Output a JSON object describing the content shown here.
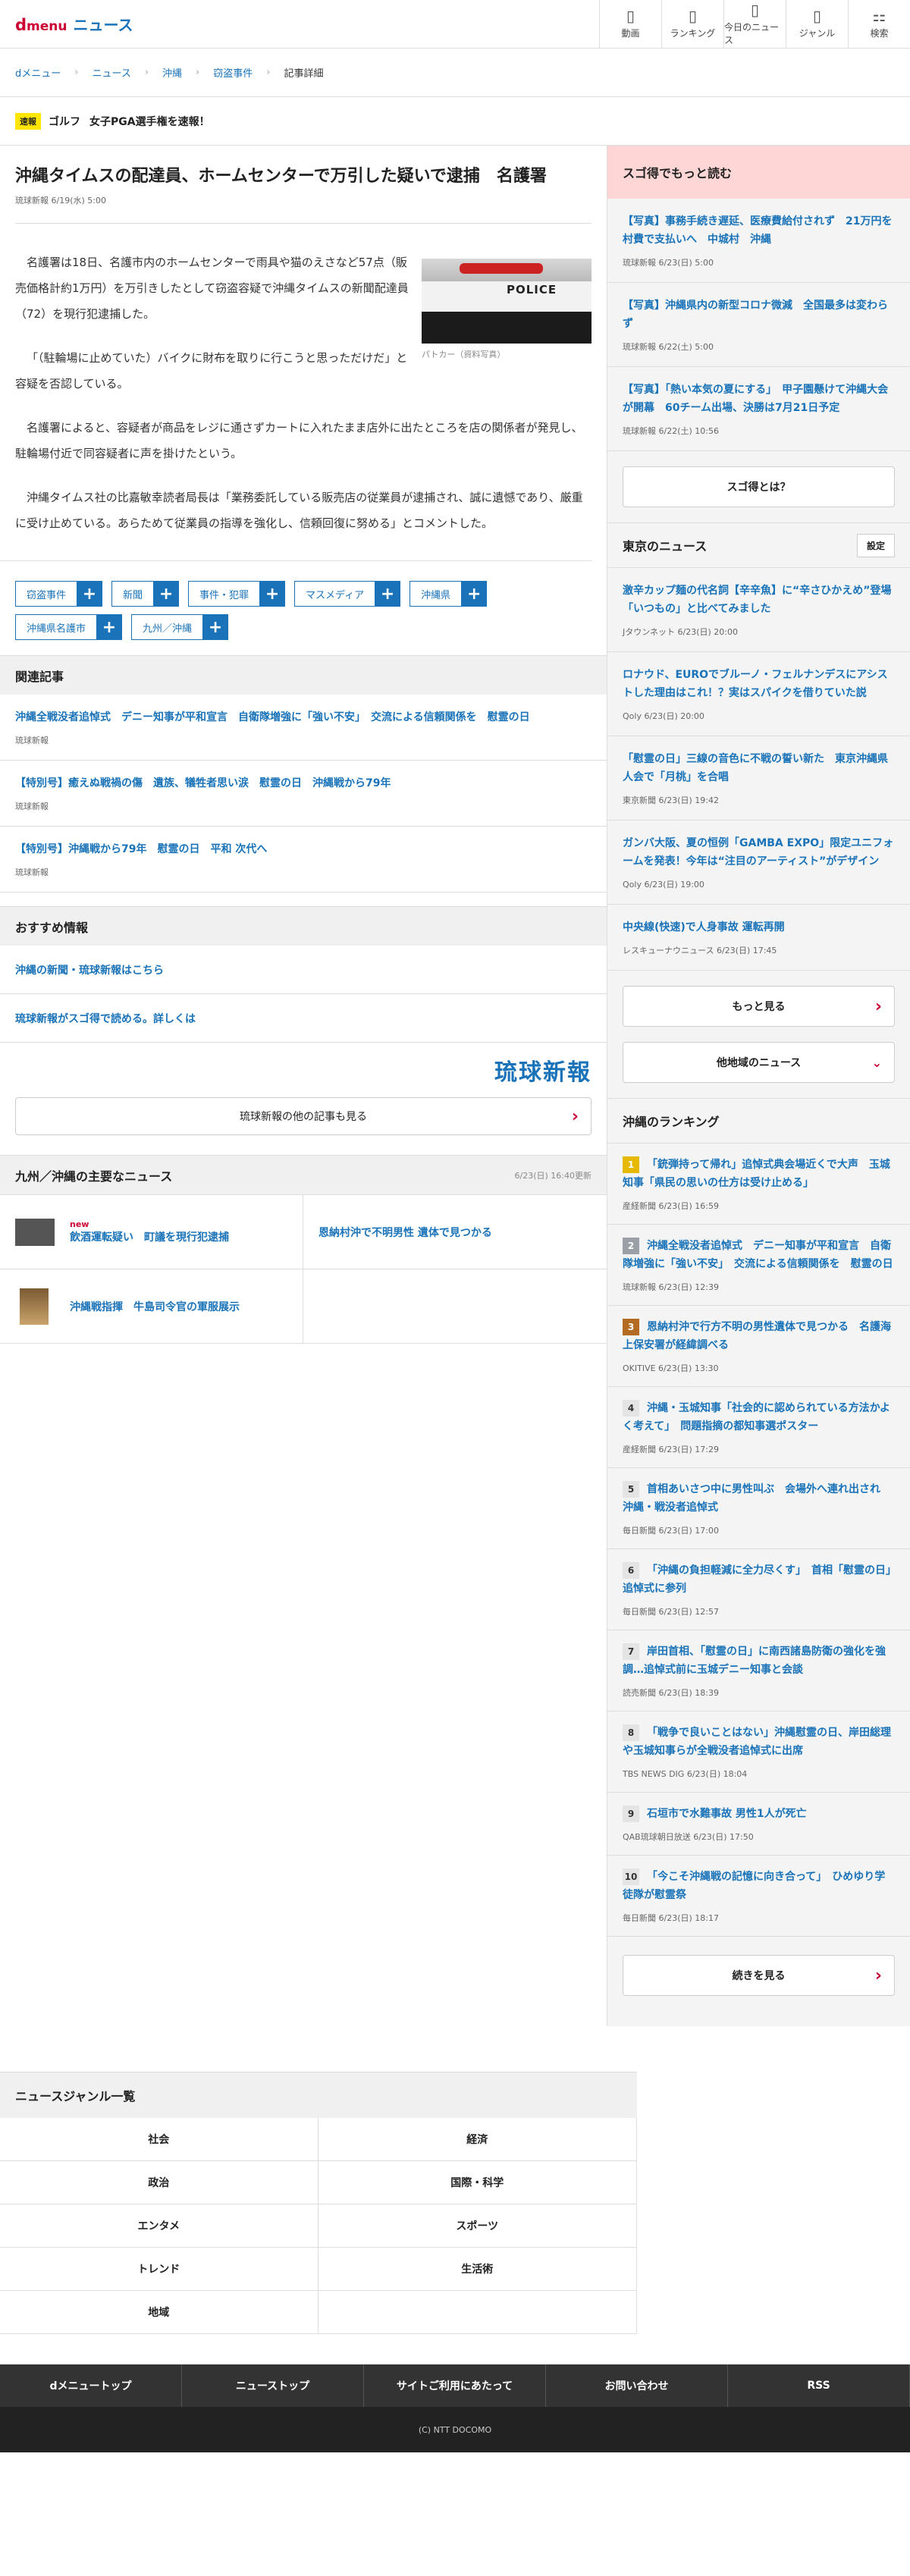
{
  "header": {
    "logo_d": "d",
    "logo_menu": "menu",
    "site": "ニュース",
    "nav": [
      {
        "icon": "video-icon",
        "glyph": "▯",
        "label": "動画"
      },
      {
        "icon": "ranking-icon",
        "glyph": "▯",
        "label": "ランキング"
      },
      {
        "icon": "today-news-icon",
        "glyph": "▯",
        "label": "今日のニュース"
      },
      {
        "icon": "genre-icon",
        "glyph": "▯",
        "label": "ジャンル"
      },
      {
        "icon": "search-icon",
        "glyph": "⚏",
        "label": "検索"
      }
    ]
  },
  "breadcrumb": [
    "dメニュー",
    "ニュース",
    "沖縄",
    "窃盗事件",
    "記事詳細"
  ],
  "alert": {
    "tag": "速報",
    "category": "ゴルフ",
    "text": "女子PGA選手権を速報！"
  },
  "article": {
    "title": "沖縄タイムスの配達員、ホームセンターで万引した疑いで逮捕　名護署",
    "source": "琉球新報",
    "date": "6/19(水) 5:00",
    "photo_text": "POLICE",
    "photo_caption": "パトカー（資料写真）",
    "paragraphs": [
      "名護署は18日、名護市内のホームセンターで雨具や猫のえさなど57点（販売価格計約1万円）を万引きしたとして窃盗容疑で沖縄タイムスの新聞配達員（72）を現行犯逮捕した。",
      "「（駐輪場に止めていた）バイクに財布を取りに行こうと思っただけだ」と容疑を否認している。",
      "名護署によると、容疑者が商品をレジに通さずカートに入れたまま店外に出たところを店の関係者が発見し、駐輪場付近で同容疑者に声を掛けたという。",
      "沖縄タイムス社の比嘉敏幸読者局長は「業務委託している販売店の従業員が逮捕され、誠に遺憾であり、厳重に受け止めている。あらためて従業員の指導を強化し、信頼回復に努める」とコメントした。"
    ],
    "tags": [
      "窃盗事件",
      "新聞",
      "事件・犯罪",
      "マスメディア",
      "沖縄県",
      "沖縄県名護市",
      "九州／沖縄"
    ],
    "tag_plus": "+"
  },
  "related": {
    "heading": "関連記事",
    "items": [
      {
        "title": "沖縄全戦没者追悼式　デニー知事が平和宣言　自衛隊増強に「強い不安」　交流による信頼関係を　慰霊の日",
        "source": "琉球新報"
      },
      {
        "title": "【特別号】癒えぬ戦禍の傷　遺族、犠牲者思い涙　慰霊の日　沖縄戦から79年",
        "source": "琉球新報"
      },
      {
        "title": "【特別号】沖縄戦から79年　慰霊の日　平和 次代へ",
        "source": "琉球新報"
      }
    ]
  },
  "recommend": {
    "heading": "おすすめ情報",
    "items": [
      "沖縄の新聞・琉球新報はこちら",
      "琉球新報がスゴ得で読める。詳しくは"
    ],
    "logo": "琉球新報",
    "more": "琉球新報の他の記事も見る",
    "chevron": "›"
  },
  "regional": {
    "heading": "九州／沖縄の主要なニュース",
    "time": "6/23(日) 16:40更新",
    "new_badge": "new",
    "items": [
      "飲酒運転疑い　町議を現行犯逮捕",
      "恩納村沖で不明男性 遺体で見つかる",
      "沖縄戦指揮　牛島司令官の軍服展示",
      ""
    ]
  },
  "sidebar": {
    "sugotoku_heading": "スゴ得でもっと読む",
    "sugotoku_items": [
      {
        "title": "【写真】事務手続き遅延、医療費給付されず　21万円を村費で支払いへ　中城村　沖縄",
        "meta": "琉球新報 6/23(日) 5:00"
      },
      {
        "title": "【写真】沖縄県内の新型コロナ微減　全国最多は変わらず",
        "meta": "琉球新報 6/22(土) 5:00"
      },
      {
        "title": "【写真】「熱い本気の夏にする」　甲子園懸けて沖縄大会が開幕　60チーム出場、決勝は7月21日予定",
        "meta": "琉球新報 6/22(土) 10:56"
      }
    ],
    "sugotoku_btn": "スゴ得とは？",
    "tokyo_heading": "東京のニュース",
    "tokyo_setting": "設定",
    "tokyo_items": [
      {
        "title": "激辛カップ麺の代名詞【辛辛魚】に“辛さひかえめ”登場　「いつもの」と比べてみました",
        "meta": "Jタウンネット 6/23(日) 20:00"
      },
      {
        "title": "ロナウド、EUROでブルーノ・フェルナンデスにアシストした理由はこれ！？実はスパイクを借りていた説",
        "meta": "Qoly 6/23(日) 20:00"
      },
      {
        "title": "「慰霊の日」三線の音色に不戦の誓い新た　東京沖縄県人会で「月桃」を合唱",
        "meta": "東京新聞 6/23(日) 19:42"
      },
      {
        "title": "ガンバ大阪、夏の恒例「GAMBA EXPO」限定ユニフォームを発表！今年は“注目のアーティスト”がデザイン",
        "meta": "Qoly 6/23(日) 19:00"
      },
      {
        "title": "中央線(快速)で人身事故 運転再開",
        "meta": "レスキューナウニュース 6/23(日) 17:45"
      }
    ],
    "more_btn": "もっと見る",
    "other_btn": "他地域のニュース",
    "down": "⌄",
    "ranking_heading": "沖縄のランキング",
    "ranking": [
      {
        "num": "1",
        "title": "「銃弾持って帰れ」追悼式典会場近くで大声　玉城知事「県民の思いの仕方は受け止める」",
        "meta": "産経新聞 6/23(日) 16:59"
      },
      {
        "num": "2",
        "title": "沖縄全戦没者追悼式　デニー知事が平和宣言　自衛隊増強に「強い不安」　交流による信頼関係を　慰霊の日",
        "meta": "琉球新報 6/23(日) 12:39"
      },
      {
        "num": "3",
        "title": "恩納村沖で行方不明の男性遺体で見つかる　名護海上保安署が経緯調べる",
        "meta": "OKITIVE 6/23(日) 13:30"
      },
      {
        "num": "4",
        "title": "沖縄・玉城知事「社会的に認められている方法かよく考えて」　問題指摘の都知事選ポスター",
        "meta": "産経新聞 6/23(日) 17:29"
      },
      {
        "num": "5",
        "title": "首相あいさつ中に男性叫ぶ　会場外へ連れ出され　沖縄・戦没者追悼式",
        "meta": "毎日新聞 6/23(日) 17:00"
      },
      {
        "num": "6",
        "title": "「沖縄の負担軽減に全力尽くす」　首相「慰霊の日」追悼式に参列",
        "meta": "毎日新聞 6/23(日) 12:57"
      },
      {
        "num": "7",
        "title": "岸田首相、「慰霊の日」に南西諸島防衛の強化を強調…追悼式前に玉城デニー知事と会談",
        "meta": "読売新聞 6/23(日) 18:39"
      },
      {
        "num": "8",
        "title": "「戦争で良いことはない」沖縄慰霊の日、岸田総理や玉城知事らが全戦没者追悼式に出席",
        "meta": "TBS NEWS DIG 6/23(日) 18:04"
      },
      {
        "num": "9",
        "title": "石垣市で水難事故 男性1人が死亡",
        "meta": "QAB琉球朝日放送 6/23(日) 17:50"
      },
      {
        "num": "10",
        "title": "「今こそ沖縄戦の記憶に向き合って」　ひめゆり学徒隊が慰霊祭",
        "meta": "毎日新聞 6/23(日) 18:17"
      }
    ],
    "continue_btn": "続きを見る"
  },
  "genres": {
    "heading": "ニュースジャンル一覧",
    "items": [
      "社会",
      "経済",
      "政治",
      "国際・科学",
      "エンタメ",
      "スポーツ",
      "トレンド",
      "生活術",
      "地域",
      ""
    ]
  },
  "footer": {
    "links": [
      "dメニュートップ",
      "ニューストップ",
      "サイトご利用にあたって",
      "お問い合わせ",
      "RSS"
    ],
    "copyright": "(C) NTT DOCOMO"
  }
}
